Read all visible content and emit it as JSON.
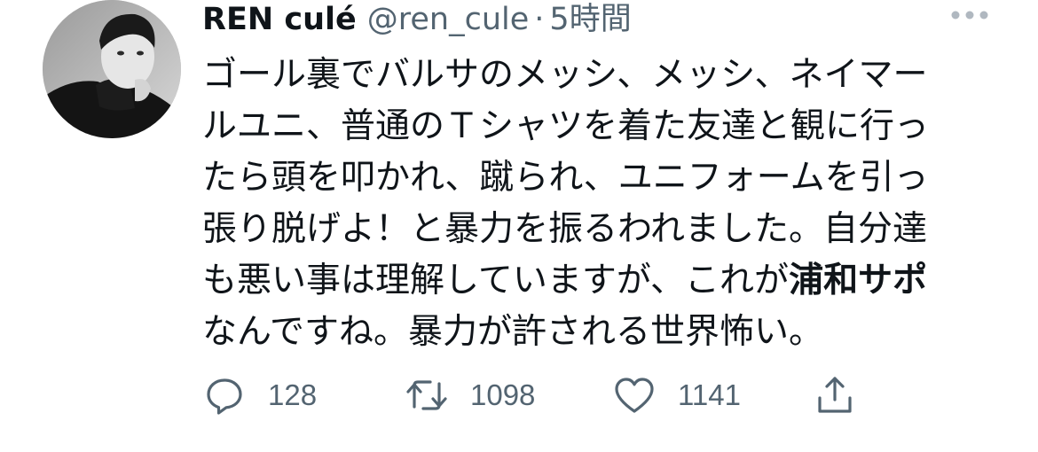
{
  "tweet": {
    "display_name": "REN culé",
    "handle": "@ren_cule",
    "separator": "·",
    "time": "5時間",
    "text_lines": [
      "ゴール裏でバルサのメッシ、メッシ、ネイマー",
      "ルユニ、普通のＴシャツを着た友達と観に行っ",
      "たら頭を叩かれ、蹴られ、ユニフォームを引っ",
      "張り脱げよ！と暴力を振るわれました。自分達",
      "も悪い事は理解していますが、これが",
      "なんですね。暴力が許される世界怖い。"
    ],
    "bold_text": "浦和サポ"
  },
  "actions": {
    "replies": "128",
    "retweets": "1098",
    "likes": "1141"
  },
  "icons": {
    "avatar": "avatar-photo",
    "more": "more-icon",
    "reply": "reply-icon",
    "retweet": "retweet-icon",
    "like": "heart-icon",
    "share": "share-icon"
  },
  "colors": {
    "text": "#0f1419",
    "secondary": "#536471",
    "background": "#ffffff"
  }
}
